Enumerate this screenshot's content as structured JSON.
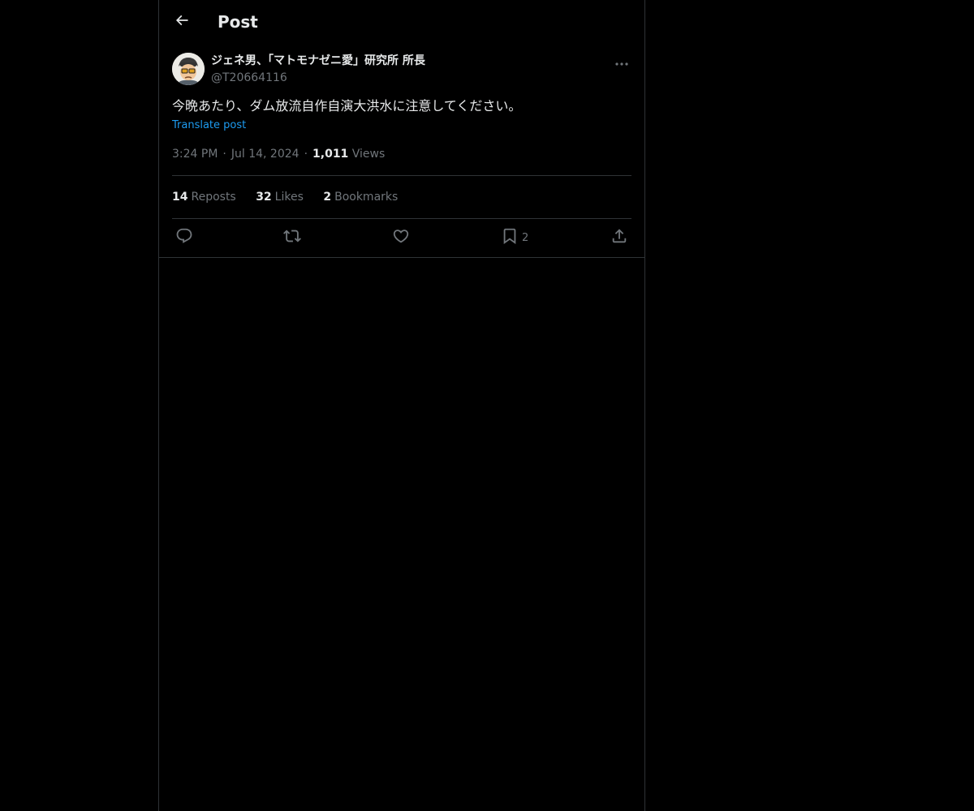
{
  "header": {
    "title": "Post",
    "back_icon": "arrow-left-icon"
  },
  "post": {
    "display_name": "ジェネ男、「マトモナゼニ愛」研究所 所長",
    "handle": "@T20664116",
    "text": "今晩あたり、ダム放流自作自演大洪水に注意してください。",
    "translate_label": "Translate post",
    "time": "3:24 PM",
    "date": "Jul 14, 2024",
    "views_count": "1,011",
    "views_label": "Views"
  },
  "stats": {
    "reposts_count": "14",
    "reposts_label": "Reposts",
    "likes_count": "32",
    "likes_label": "Likes",
    "bookmarks_count": "2",
    "bookmarks_label": "Bookmarks"
  },
  "actions": {
    "reply_icon": "reply-icon",
    "repost_icon": "repost-icon",
    "like_icon": "heart-icon",
    "bookmark_icon": "bookmark-icon",
    "bookmark_count": "2",
    "share_icon": "share-icon"
  },
  "colors": {
    "background": "#000000",
    "text": "#e7e9ea",
    "secondary": "#71767b",
    "link": "#1d9bf0",
    "border": "#2f3336"
  }
}
